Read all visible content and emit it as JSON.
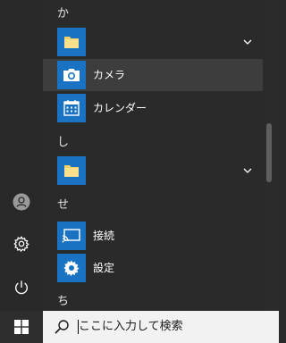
{
  "start_menu": {
    "sections": [
      {
        "letter": "か",
        "apps": [
          {
            "label": "",
            "icon": "folder-icon",
            "expandable": true
          },
          {
            "label": "カメラ",
            "icon": "camera-icon",
            "expandable": false,
            "highlighted": true
          },
          {
            "label": "カレンダー",
            "icon": "calendar-icon",
            "expandable": false
          }
        ]
      },
      {
        "letter": "し",
        "apps": [
          {
            "label": "",
            "icon": "folder-icon",
            "expandable": true
          }
        ]
      },
      {
        "letter": "せ",
        "apps": [
          {
            "label": "接続",
            "icon": "connect-icon",
            "expandable": false
          },
          {
            "label": "設定",
            "icon": "gear-icon",
            "expandable": false
          }
        ]
      },
      {
        "letter": "ち",
        "apps": []
      }
    ],
    "rail": {
      "user_icon": "user-icon",
      "settings_icon": "gear-icon",
      "power_icon": "power-icon"
    }
  },
  "taskbar": {
    "start_icon": "windows-icon",
    "search_placeholder": "ここに入力して検索"
  },
  "colors": {
    "tile_blue": "#1a73c2",
    "menu_bg": "#2b2b2b",
    "highlight": "#3d3d3d",
    "folder_yellow": "#f4d069"
  }
}
